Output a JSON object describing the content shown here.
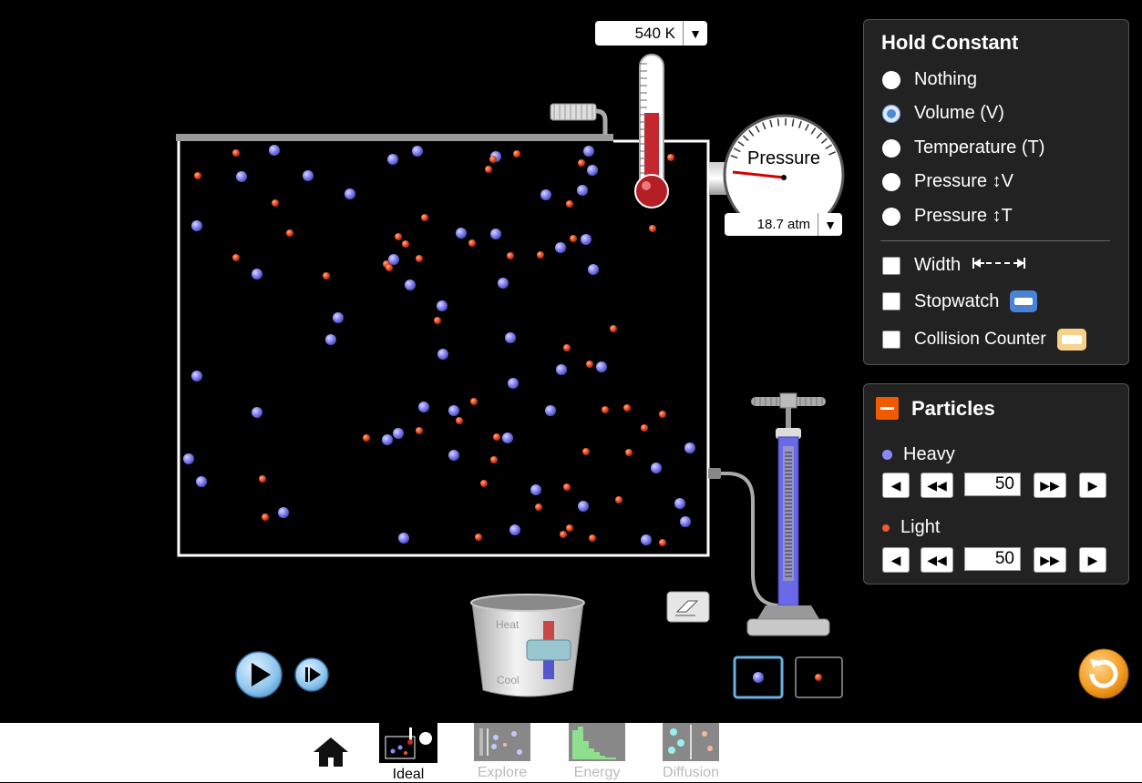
{
  "thermometer": {
    "value": "540 K",
    "arrow": "▼"
  },
  "gauge": {
    "label": "Pressure",
    "value": "18.7 atm",
    "arrow": "▼"
  },
  "heater": {
    "heat_label": "Heat",
    "cool_label": "Cool"
  },
  "hold_constant": {
    "title": "Hold Constant",
    "options": [
      {
        "label": "Nothing",
        "selected": false
      },
      {
        "label": "Volume (V)",
        "selected": true
      },
      {
        "label": "Temperature (T)",
        "selected": false
      },
      {
        "label": "Pressure ↕V",
        "selected": false
      },
      {
        "label": "Pressure ↕T",
        "selected": false
      }
    ],
    "tools": [
      {
        "label": "Width",
        "icon": "width-arrows-icon",
        "checked": false
      },
      {
        "label": "Stopwatch",
        "icon": "stopwatch-icon",
        "checked": false
      },
      {
        "label": "Collision Counter",
        "icon": "collision-counter-icon",
        "checked": false
      }
    ]
  },
  "particles": {
    "title": "Particles",
    "collapse_icon": "minus-icon",
    "heavy": {
      "label": "Heavy",
      "count": "50",
      "color": "#8a8aff"
    },
    "light": {
      "label": "Light",
      "count": "50",
      "color": "#ef5a2e"
    }
  },
  "nav": {
    "home_icon": "home-icon",
    "tabs": [
      {
        "label": "Ideal",
        "active": true
      },
      {
        "label": "Explore",
        "active": false
      },
      {
        "label": "Energy",
        "active": false
      },
      {
        "label": "Diffusion",
        "active": false
      }
    ]
  },
  "colors": {
    "accent_reset": "#f29a1f",
    "panel_bg": "#222222",
    "container_wall": "#ffffff"
  }
}
